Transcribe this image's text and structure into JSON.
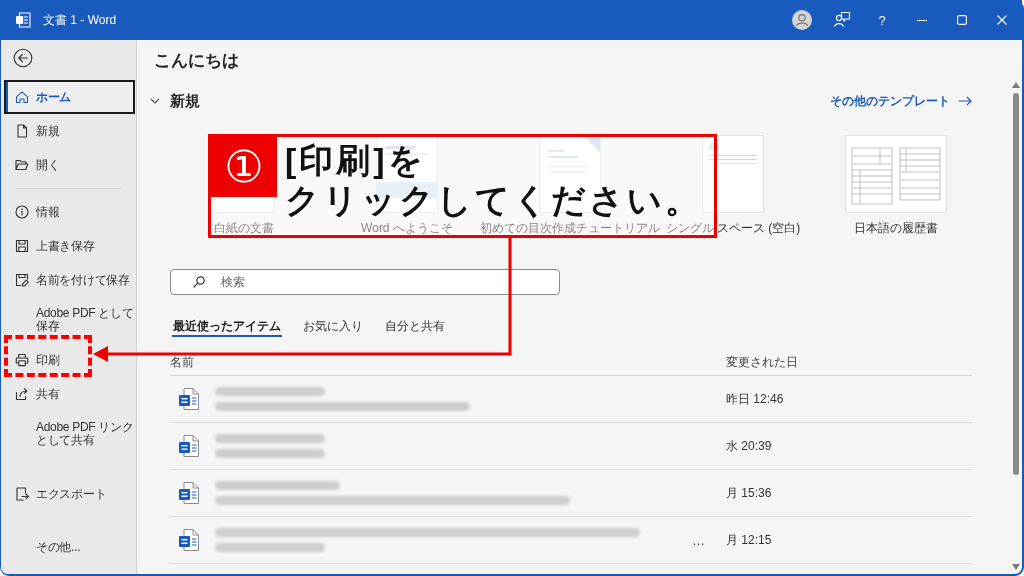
{
  "title_bar": {
    "title": "文書 1 - Word",
    "help": "?"
  },
  "sidebar": {
    "items": [
      {
        "kind": "home",
        "label": "ホーム",
        "selected": true
      },
      {
        "kind": "new",
        "label": "新規",
        "selected": false
      },
      {
        "kind": "open",
        "label": "開く",
        "selected": false
      },
      {
        "kind": "divider"
      },
      {
        "kind": "info",
        "label": "情報",
        "selected": false
      },
      {
        "kind": "save",
        "label": "上書き保存",
        "selected": false
      },
      {
        "kind": "save-as",
        "label": "名前を付けて保存",
        "selected": false
      },
      {
        "kind": "pdf",
        "label": "Adobe PDF として保存",
        "selected": false
      },
      {
        "kind": "print",
        "label": "印刷",
        "selected": false
      },
      {
        "kind": "share",
        "label": "共有",
        "selected": false
      },
      {
        "kind": "pdf-link",
        "label": "Adobe PDF リンクとして共有",
        "selected": false
      },
      {
        "kind": "export",
        "label": "エクスポート",
        "selected": false
      },
      {
        "kind": "more",
        "label": "その他...",
        "selected": false
      }
    ]
  },
  "home": {
    "greeting": "こんにちは",
    "new_section": {
      "title": "新規",
      "expanded": true,
      "more_templates": "その他のテンプレート",
      "templates": [
        {
          "kind": "blank",
          "label": "白紙の文書"
        },
        {
          "kind": "welcome",
          "label": "Word へようこそ"
        },
        {
          "kind": "toc",
          "label": "初めての目次作成チュートリアル"
        },
        {
          "kind": "single",
          "label": "シングル スペース (空白)"
        },
        {
          "kind": "resume",
          "label": "日本語の履歴書"
        }
      ]
    },
    "search": {
      "placeholder": "検索"
    },
    "tabs": [
      {
        "label": "最近使ったアイテム",
        "selected": true
      },
      {
        "label": "お気に入り",
        "selected": false
      },
      {
        "label": "自分と共有",
        "selected": false
      }
    ],
    "table": {
      "columns": [
        "名前",
        "変更された日"
      ],
      "rows": [
        {
          "modified": "昨日 12:46"
        },
        {
          "modified": "水 20:39"
        },
        {
          "modified": "月 15:36"
        },
        {
          "modified": "月 12:15",
          "more": "…"
        }
      ]
    }
  },
  "annotation": {
    "step": "①",
    "lines": [
      "[印刷]を",
      "クリックしてください。"
    ]
  }
}
